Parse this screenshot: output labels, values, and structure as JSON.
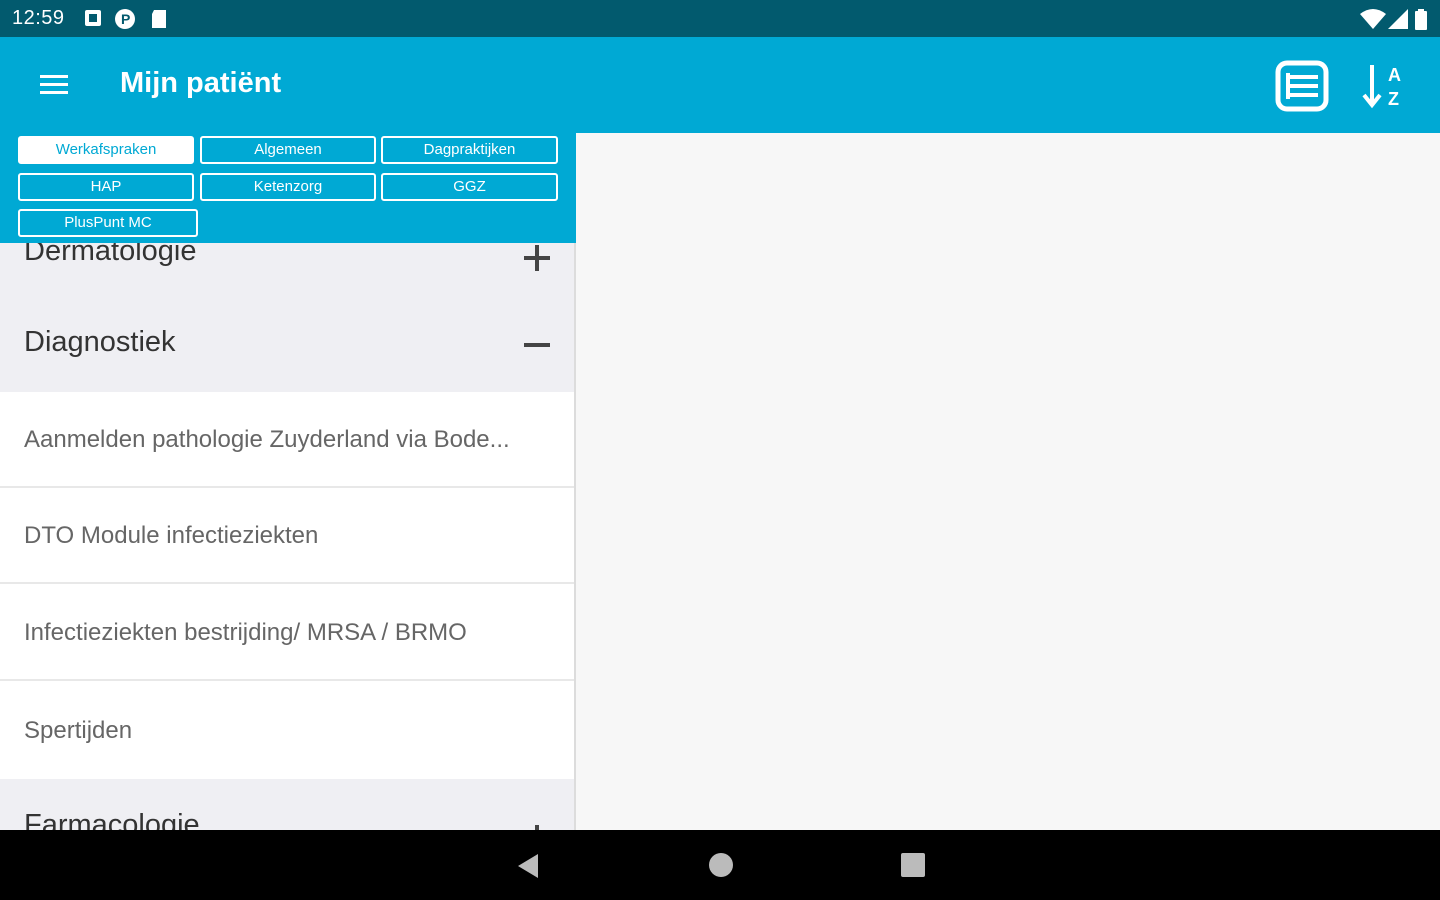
{
  "status_bar": {
    "time": "12:59",
    "icons": [
      "notification-icon",
      "p-app-icon",
      "sd-card-icon",
      "wifi-icon",
      "signal-icon",
      "battery-icon"
    ]
  },
  "app_bar": {
    "title": "Mijn patiënt",
    "menu_icon": "menu-icon",
    "list_icon": "list-view-icon",
    "sort_icon": "sort-az-icon",
    "sort_letters": [
      "A",
      "Z"
    ]
  },
  "filter_chips": [
    {
      "label": "Werkafspraken",
      "active": true
    },
    {
      "label": "Algemeen",
      "active": false
    },
    {
      "label": "Dagpraktijken",
      "active": false
    },
    {
      "label": "HAP",
      "active": false
    },
    {
      "label": "Ketenzorg",
      "active": false
    },
    {
      "label": "GGZ",
      "active": false
    },
    {
      "label": "PlusPunt MC",
      "active": false
    }
  ],
  "list": {
    "sections": [
      {
        "label": "Dermatologie",
        "toggle": "+",
        "expanded": false
      },
      {
        "label": "Diagnostiek",
        "toggle": "−",
        "expanded": true
      },
      {
        "label": "Farmacologie",
        "toggle": "+",
        "expanded": false
      }
    ],
    "items": [
      {
        "label": "Aanmelden pathologie Zuyderland via Bode..."
      },
      {
        "label": "DTO Module infectieziekten"
      },
      {
        "label": "Infectieziekten bestrijding/ MRSA / BRMO"
      },
      {
        "label": "Spertijden"
      }
    ]
  },
  "colors": {
    "status_bar": "#025a6e",
    "app_bar": "#00a9d4",
    "section_bg": "#efeff3",
    "item_text": "#666666"
  },
  "nav_bar": {
    "icons": [
      "back-icon",
      "home-icon",
      "recents-icon"
    ]
  }
}
